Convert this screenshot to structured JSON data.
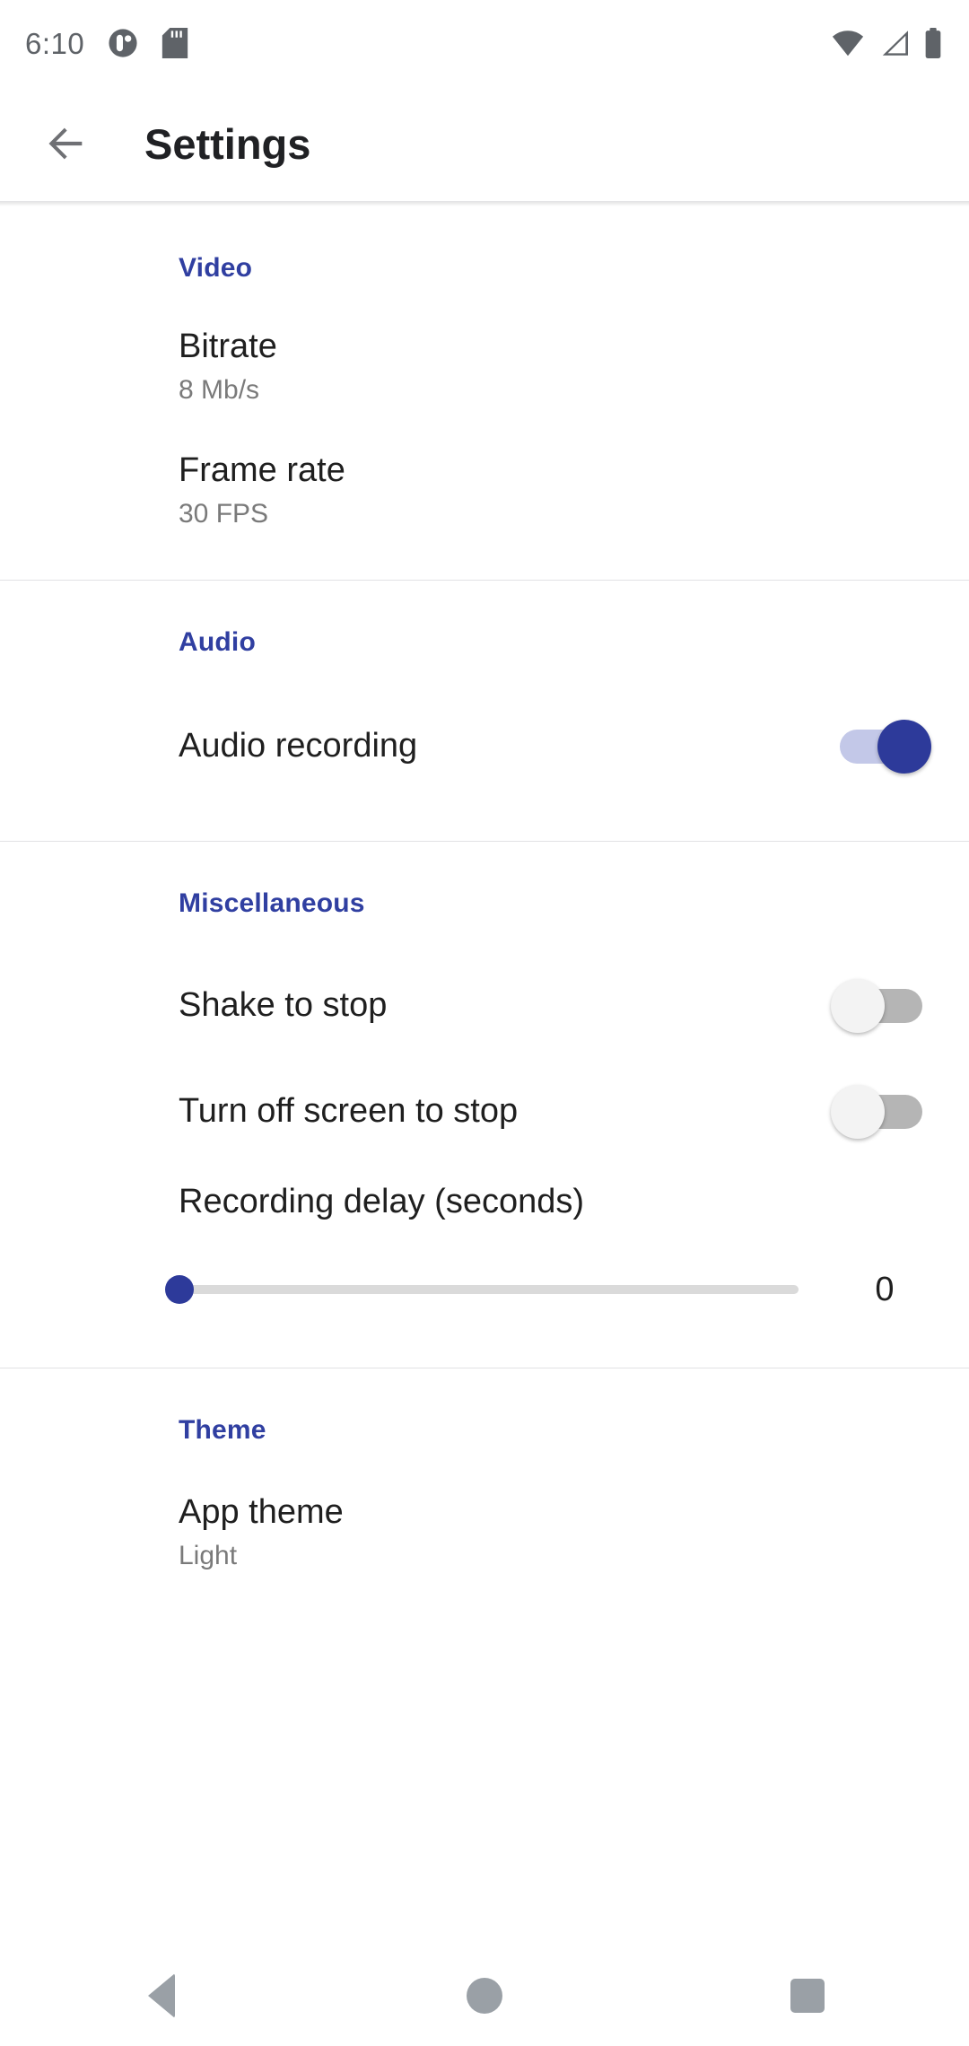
{
  "status_bar": {
    "time": "6:10",
    "left_icons": [
      "screen-record-icon",
      "sd-card-icon"
    ],
    "right_icons": [
      "wifi-icon",
      "cellular-signal-icon",
      "battery-icon"
    ],
    "icon_color": "#5f6368"
  },
  "toolbar": {
    "back_icon": "arrow-back-icon",
    "title": "Settings"
  },
  "accent_color": "#303fa1",
  "sections": [
    {
      "title": "Video",
      "rows": [
        {
          "title": "Bitrate",
          "summary": "8 Mb/s"
        },
        {
          "title": "Frame rate",
          "summary": "30 FPS"
        }
      ]
    },
    {
      "title": "Audio",
      "rows": [
        {
          "title": "Audio recording",
          "switch": "on"
        }
      ]
    },
    {
      "title": "Miscellaneous",
      "rows": [
        {
          "title": "Shake to stop",
          "switch": "off"
        },
        {
          "title": "Turn off screen to stop",
          "switch": "off"
        },
        {
          "title": "Recording delay (seconds)",
          "slider_value": "0",
          "slider_min": "0",
          "slider_percent": 0
        }
      ]
    },
    {
      "title": "Theme",
      "rows": [
        {
          "title": "App theme",
          "summary": "Light"
        }
      ]
    }
  ],
  "nav_bar": {
    "back_label": "back-nav",
    "home_label": "home-nav",
    "recents_label": "recents-nav"
  }
}
